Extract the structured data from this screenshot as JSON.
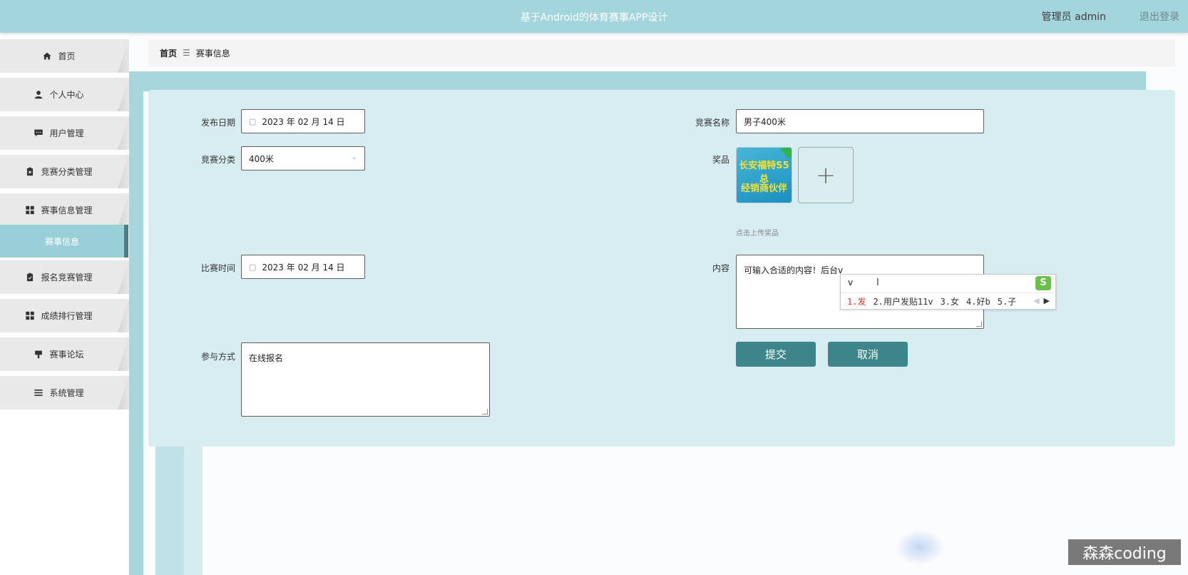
{
  "header": {
    "title": "基于Android的体育赛事APP设计",
    "user_label": "管理员 admin",
    "logout_label": "退出登录"
  },
  "sidebar": {
    "items": [
      {
        "label": "首页",
        "icon": "home-icon"
      },
      {
        "label": "个人中心",
        "icon": "user-icon"
      },
      {
        "label": "用户管理",
        "icon": "chat-icon"
      },
      {
        "label": "竞赛分类管理",
        "icon": "clipboard-icon"
      },
      {
        "label": "赛事信息管理",
        "icon": "grid-icon"
      },
      {
        "label": "赛事信息",
        "icon": ""
      },
      {
        "label": "报名竞赛管理",
        "icon": "clipboard-check-icon"
      },
      {
        "label": "成绩排行管理",
        "icon": "grid-icon"
      },
      {
        "label": "赛事论坛",
        "icon": "flag-icon"
      },
      {
        "label": "系统管理",
        "icon": "list-icon"
      }
    ]
  },
  "breadcrumb": {
    "home": "首页",
    "separator": "☰",
    "current": "赛事信息"
  },
  "form": {
    "publish_date": {
      "label": "发布日期",
      "value": "2023 年 02 月 14 日"
    },
    "competition_name": {
      "label": "竞赛名称",
      "value": "男子400米"
    },
    "category": {
      "label": "竞赛分类",
      "value": "400米"
    },
    "prize": {
      "label": "奖品",
      "image_line1": "长安福特S5总",
      "image_line2": "经销商伙伴",
      "upload_hint": "点击上传奖品"
    },
    "match_time": {
      "label": "比赛时间",
      "value": "2023 年 02 月 14 日"
    },
    "content": {
      "label": "内容",
      "value": "可输入合适的内容！后台v"
    },
    "participation": {
      "label": "参与方式",
      "value": "在线报名"
    },
    "submit_label": "提交",
    "cancel_label": "取消"
  },
  "ime": {
    "composition": "v",
    "logo": "S",
    "candidates": [
      "1.发",
      "2.用户发贴11v",
      "3.女",
      "4.好b",
      "5.子"
    ]
  },
  "watermark": "森森coding",
  "colors": {
    "header_bg": "#a3d5dc",
    "active_menu_bg": "#99d0d7",
    "button_bg": "#3e858b",
    "panel_bg": "#d8edf1"
  }
}
